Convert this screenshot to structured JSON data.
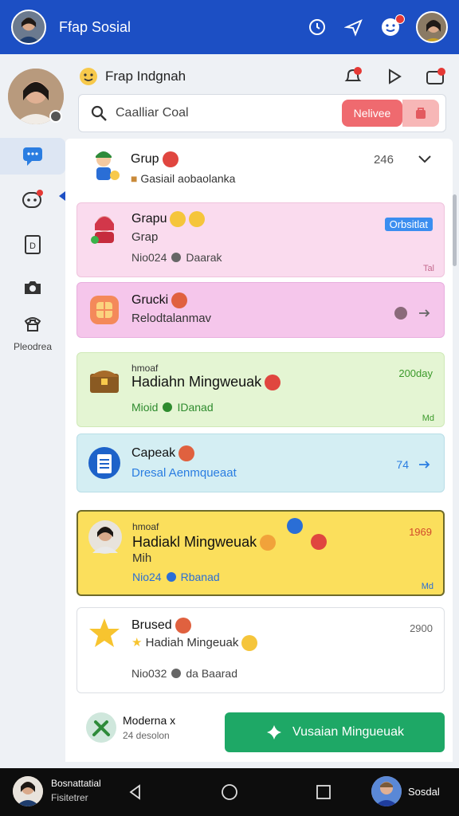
{
  "topbar": {
    "app_title": "Ffap Sosial"
  },
  "rail": {
    "last_label": "Pleodrea"
  },
  "header": {
    "title": "Frap Indgnah"
  },
  "search": {
    "placeholder": "Caalliar Coal",
    "primary_button": "Nelivee"
  },
  "cards": [
    {
      "title": "Grup",
      "subtitle": "Gasiail aobaolanka",
      "right": "246"
    },
    {
      "title": "Grapu",
      "line2": "Grap",
      "meta": "Nio024",
      "meta2": "Daarak",
      "badge": "Orbsitlat",
      "corner": "Tal"
    },
    {
      "title": "Grucki",
      "subtitle": "Relodtalanmav"
    },
    {
      "kicker": "hmoaf",
      "title": "Hadiahn Mingweuak",
      "meta": "Mioid",
      "meta2": "IDanad",
      "right": "200day",
      "corner": "Md"
    },
    {
      "title": "Capeak",
      "subtitle": "Dresal Aenmqueaat",
      "right": "74"
    },
    {
      "kicker": "hmoaf",
      "title": "Hadiakl Mingweuak",
      "line2": "Mih",
      "meta": "Nio24",
      "meta2": "Rbanad",
      "right": "1969",
      "corner": "Md"
    },
    {
      "title": "Brused",
      "line2": "Hadiah Mingeuak",
      "meta": "Nio032",
      "meta2": "da Baarad",
      "right": "2900"
    }
  ],
  "cta": {
    "name": "Moderna x",
    "sub": "24 desolon",
    "button": "Vusaian Mingueuak"
  },
  "navbar": {
    "left_line1": "Bosnattatial",
    "left_line2": "Fisitetrer",
    "right_label": "Sosdal"
  },
  "colors": {
    "primary": "#1c4fc4",
    "green": "#1ea866",
    "pink": "#fadbee",
    "magenta": "#f5c6eb",
    "lime": "#e4f5d3",
    "cyan": "#d4eef3",
    "yellow": "#fbdf5c"
  }
}
